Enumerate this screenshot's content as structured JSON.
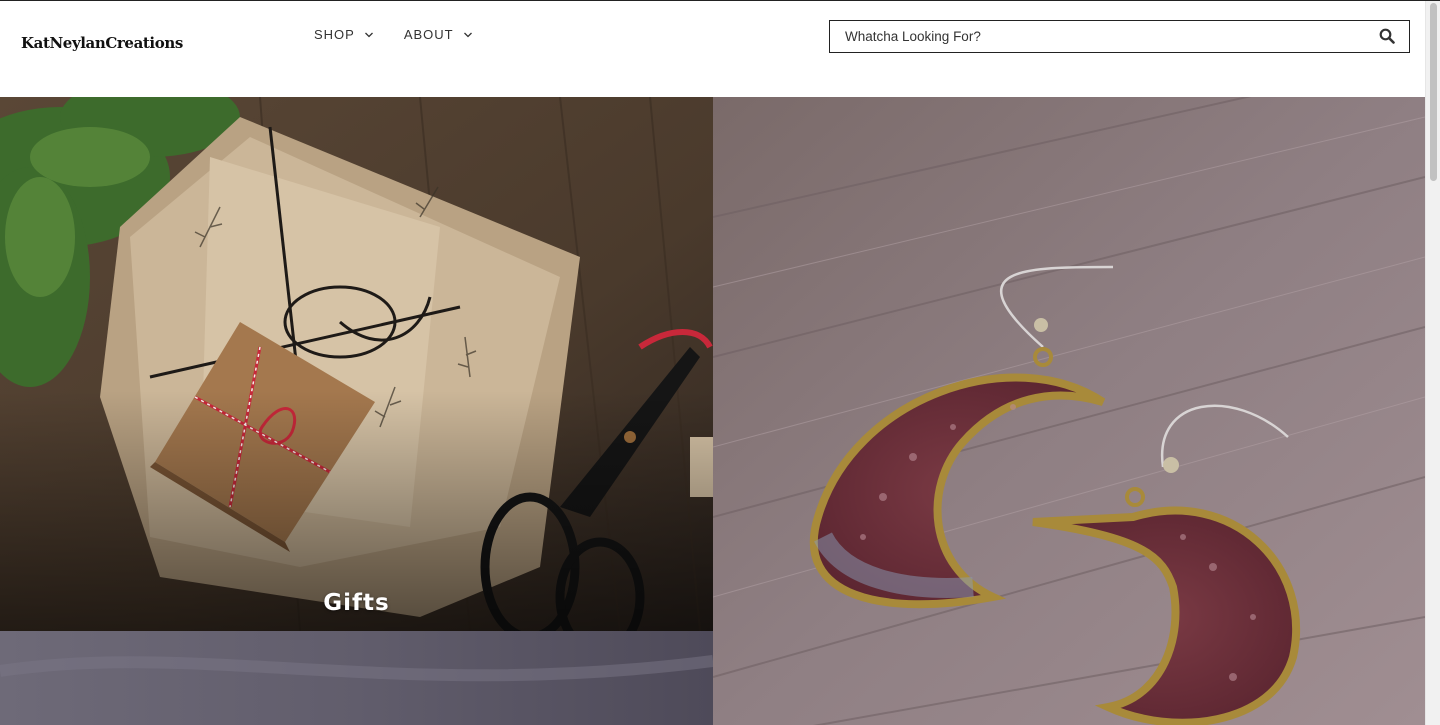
{
  "header": {
    "logo": "KatNeylanCreations",
    "nav": [
      {
        "label": "SHOP"
      },
      {
        "label": "ABOUT"
      }
    ],
    "search": {
      "placeholder": "Whatcha Looking For?",
      "icon": "search-icon"
    }
  },
  "tiles": {
    "gifts": {
      "label": "Gifts"
    },
    "earrings": {
      "label": ""
    },
    "bottom": {
      "label": ""
    }
  },
  "colors": {
    "header_bg": "#ffffff",
    "text": "#333333",
    "wood_dark": "#4a3a2e",
    "wood_pink": "#8f7f83",
    "paper": "#c9b396",
    "earring_fill": "#6e2e36",
    "earring_rim": "#a88a3a"
  }
}
